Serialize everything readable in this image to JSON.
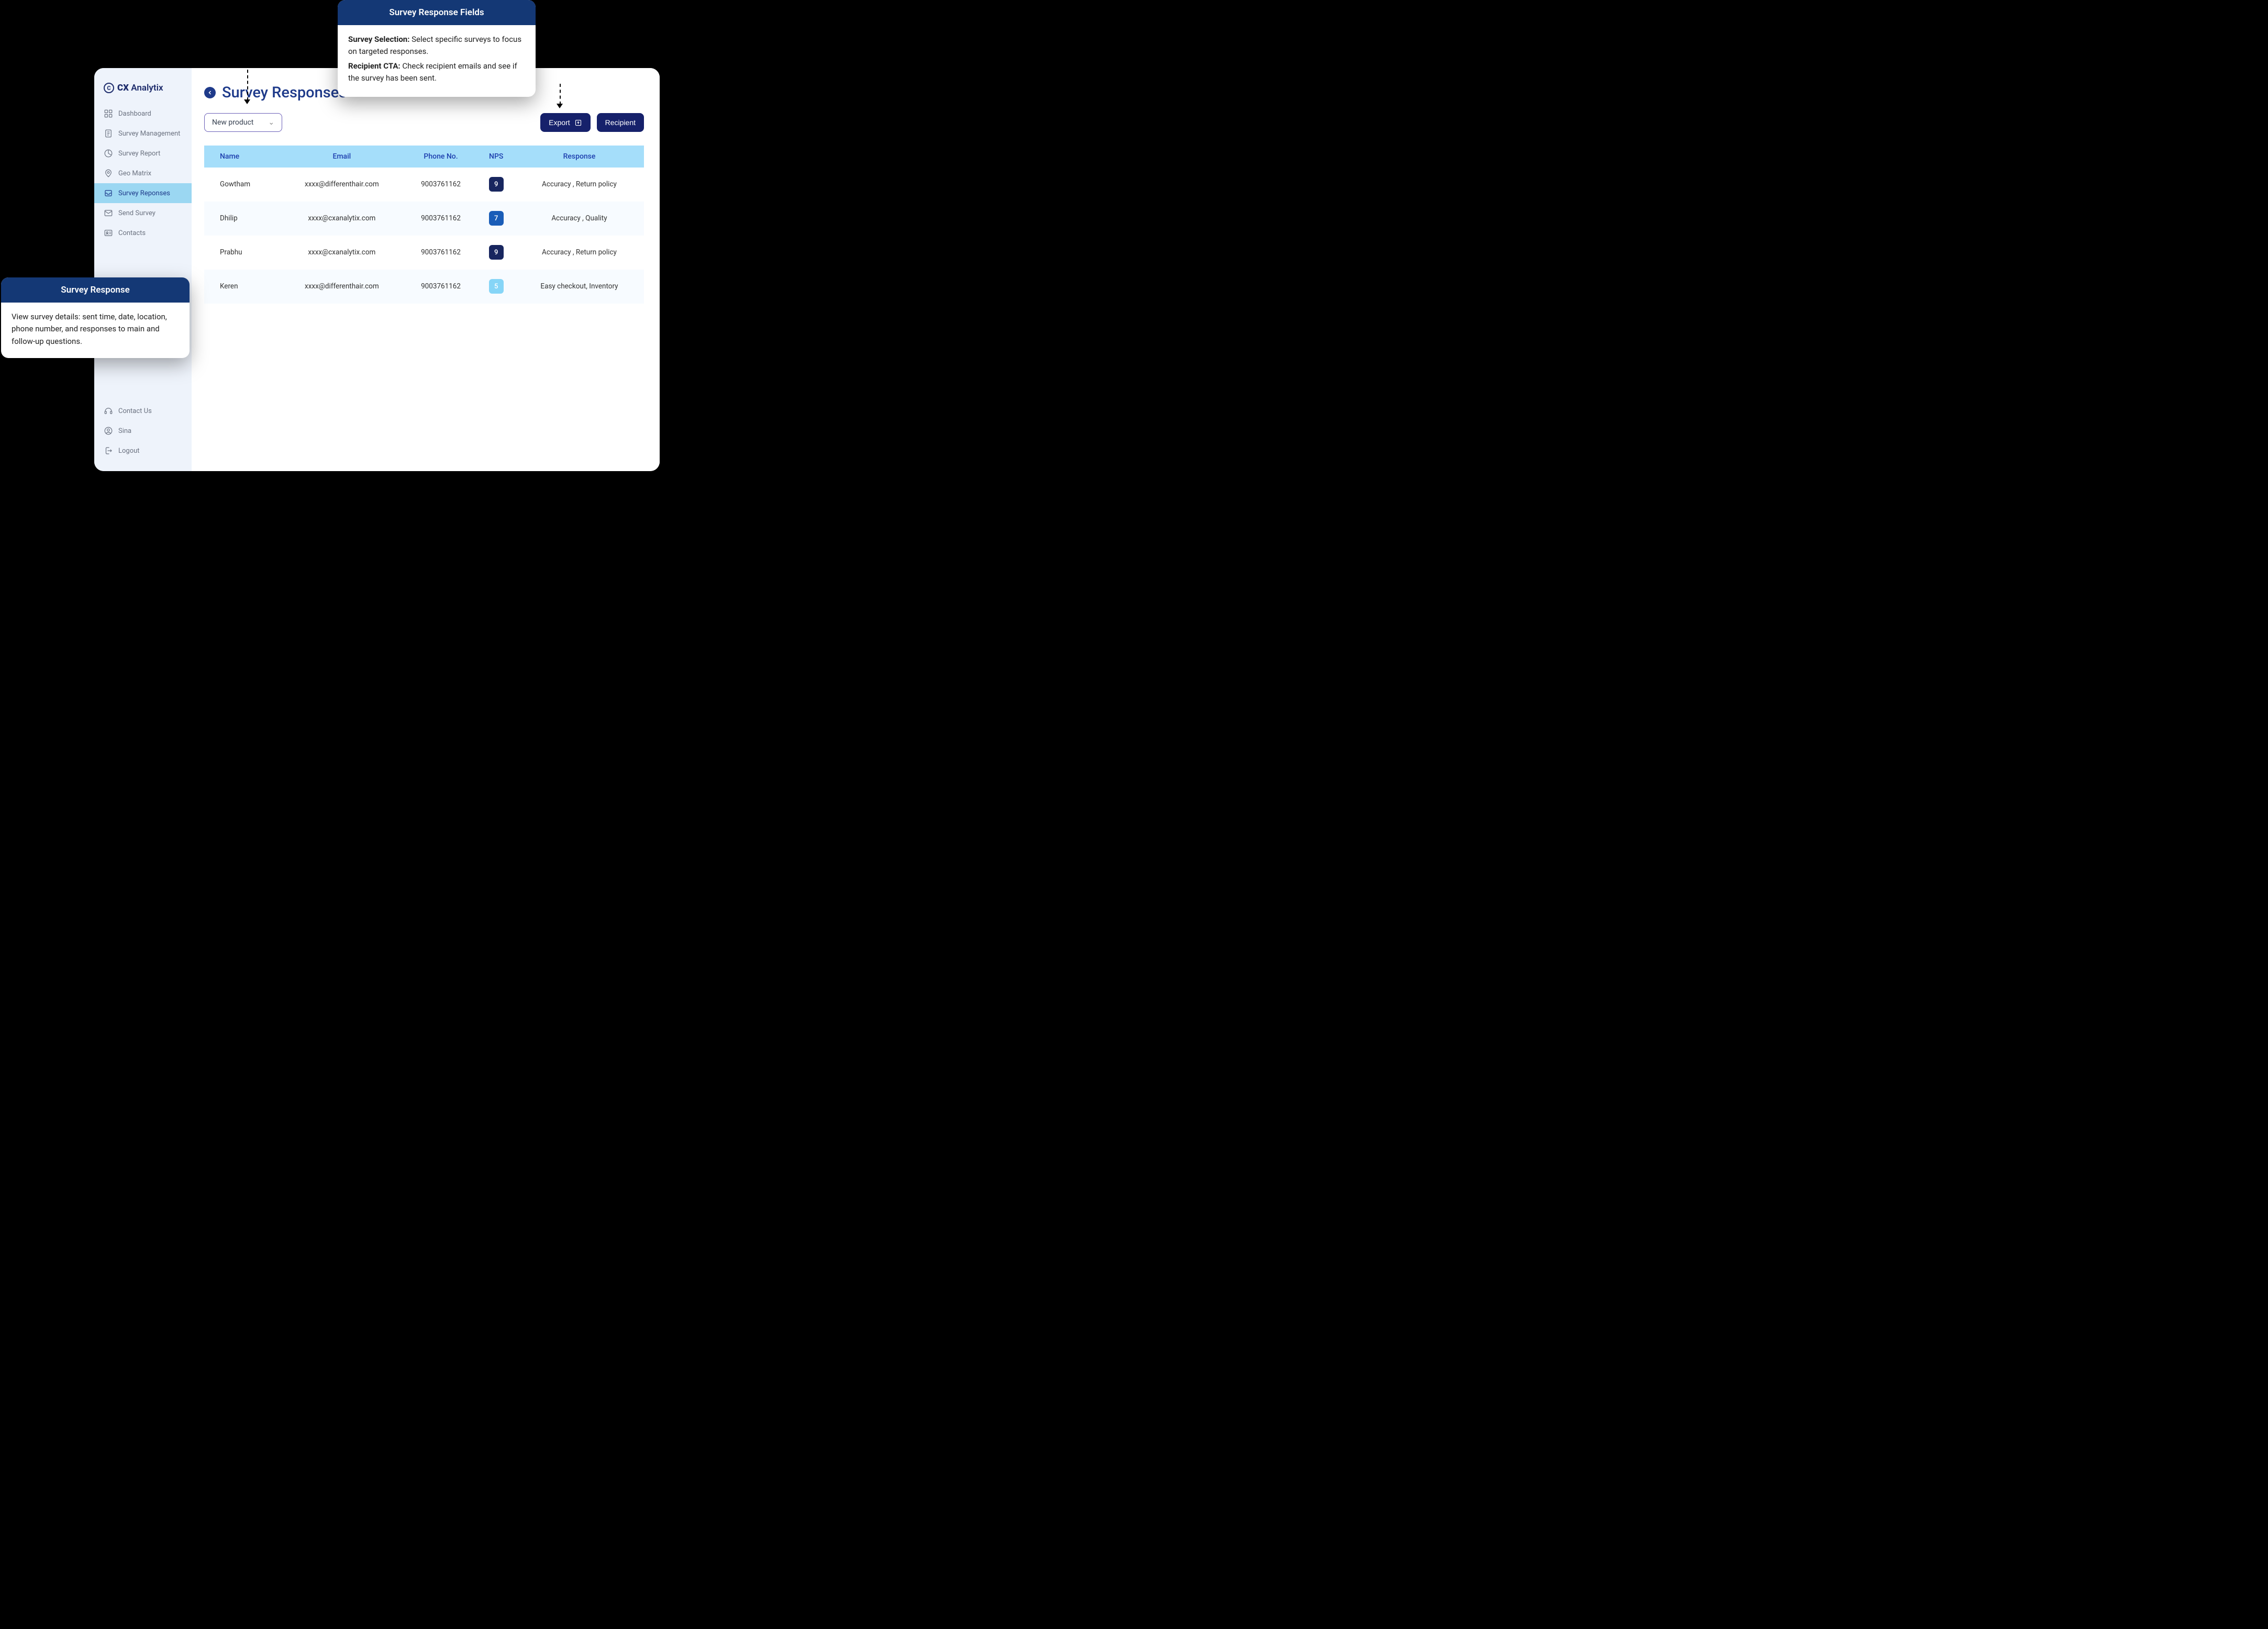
{
  "brand": {
    "mark": "C",
    "name_bold": "CX",
    "name_rest": " Analytix"
  },
  "sidebar": {
    "items": [
      {
        "label": "Dashboard"
      },
      {
        "label": "Survey Management"
      },
      {
        "label": "Survey Report"
      },
      {
        "label": "Geo Matrix"
      },
      {
        "label": "Survey Reponses"
      },
      {
        "label": "Send Survey"
      },
      {
        "label": "Contacts"
      }
    ],
    "bottom": [
      {
        "label": "Contact Us"
      },
      {
        "label": "Sina"
      },
      {
        "label": "Logout"
      }
    ]
  },
  "page": {
    "title": "Survey Responses",
    "filter_value": "New product",
    "buttons": {
      "export": "Export",
      "recipient": "Recipient"
    }
  },
  "table": {
    "cols": {
      "name": "Name",
      "email": "Email",
      "phone": "Phone No.",
      "nps": "NPS",
      "response": "Response"
    },
    "rows": [
      {
        "name": "Gowtham",
        "email": "xxxx@differenthair.com",
        "phone": "9003761162",
        "nps": "9",
        "nps_class": "nps-dark",
        "response": "Accuracy , Return policy"
      },
      {
        "name": "Dhilip",
        "email": "xxxx@cxanalytix.com",
        "phone": "9003761162",
        "nps": "7",
        "nps_class": "nps-mid",
        "response": "Accuracy , Quality"
      },
      {
        "name": "Prabhu",
        "email": "xxxx@cxanalytix.com",
        "phone": "9003761162",
        "nps": "9",
        "nps_class": "nps-dark",
        "response": "Accuracy , Return policy"
      },
      {
        "name": "Keren",
        "email": "xxxx@differenthair.com",
        "phone": "9003761162",
        "nps": "5",
        "nps_class": "nps-light",
        "response": "Easy checkout, Inventory"
      }
    ]
  },
  "callouts": {
    "left": {
      "title": "Survey Response",
      "body": "View survey details: sent time, date, location, phone number, and responses to main and follow-up questions."
    },
    "top": {
      "title": "Survey Response Fields",
      "defs": [
        {
          "term": "Survey Selection:",
          "text": " Select specific surveys to focus on targeted responses."
        },
        {
          "term": "Recipient CTA:",
          "text": " Check recipient emails and see if the survey has been sent."
        }
      ]
    }
  }
}
